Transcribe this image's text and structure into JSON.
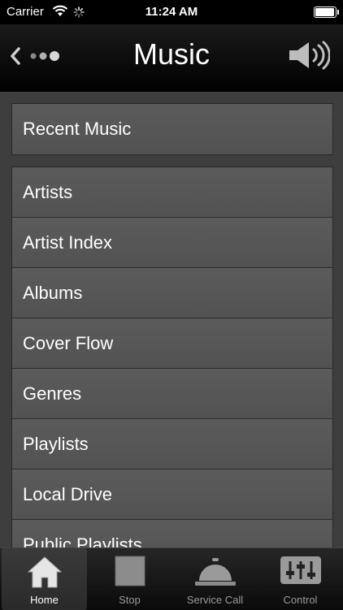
{
  "status_bar": {
    "carrier": "Carrier",
    "time": "11:24 AM",
    "battery_level": 0.95
  },
  "nav": {
    "title": "Music"
  },
  "recent_item": "Recent Music",
  "list_items": [
    "Artists",
    "Artist Index",
    "Albums",
    "Cover Flow",
    "Genres",
    "Playlists",
    "Local Drive",
    "Public Playlists"
  ],
  "tabs": [
    {
      "label": "Home",
      "icon": "home-icon",
      "active": true
    },
    {
      "label": "Stop",
      "icon": "stop-icon",
      "active": false
    },
    {
      "label": "Service Call",
      "icon": "service-bell-icon",
      "active": false
    },
    {
      "label": "Control",
      "icon": "sliders-icon",
      "active": false
    }
  ]
}
